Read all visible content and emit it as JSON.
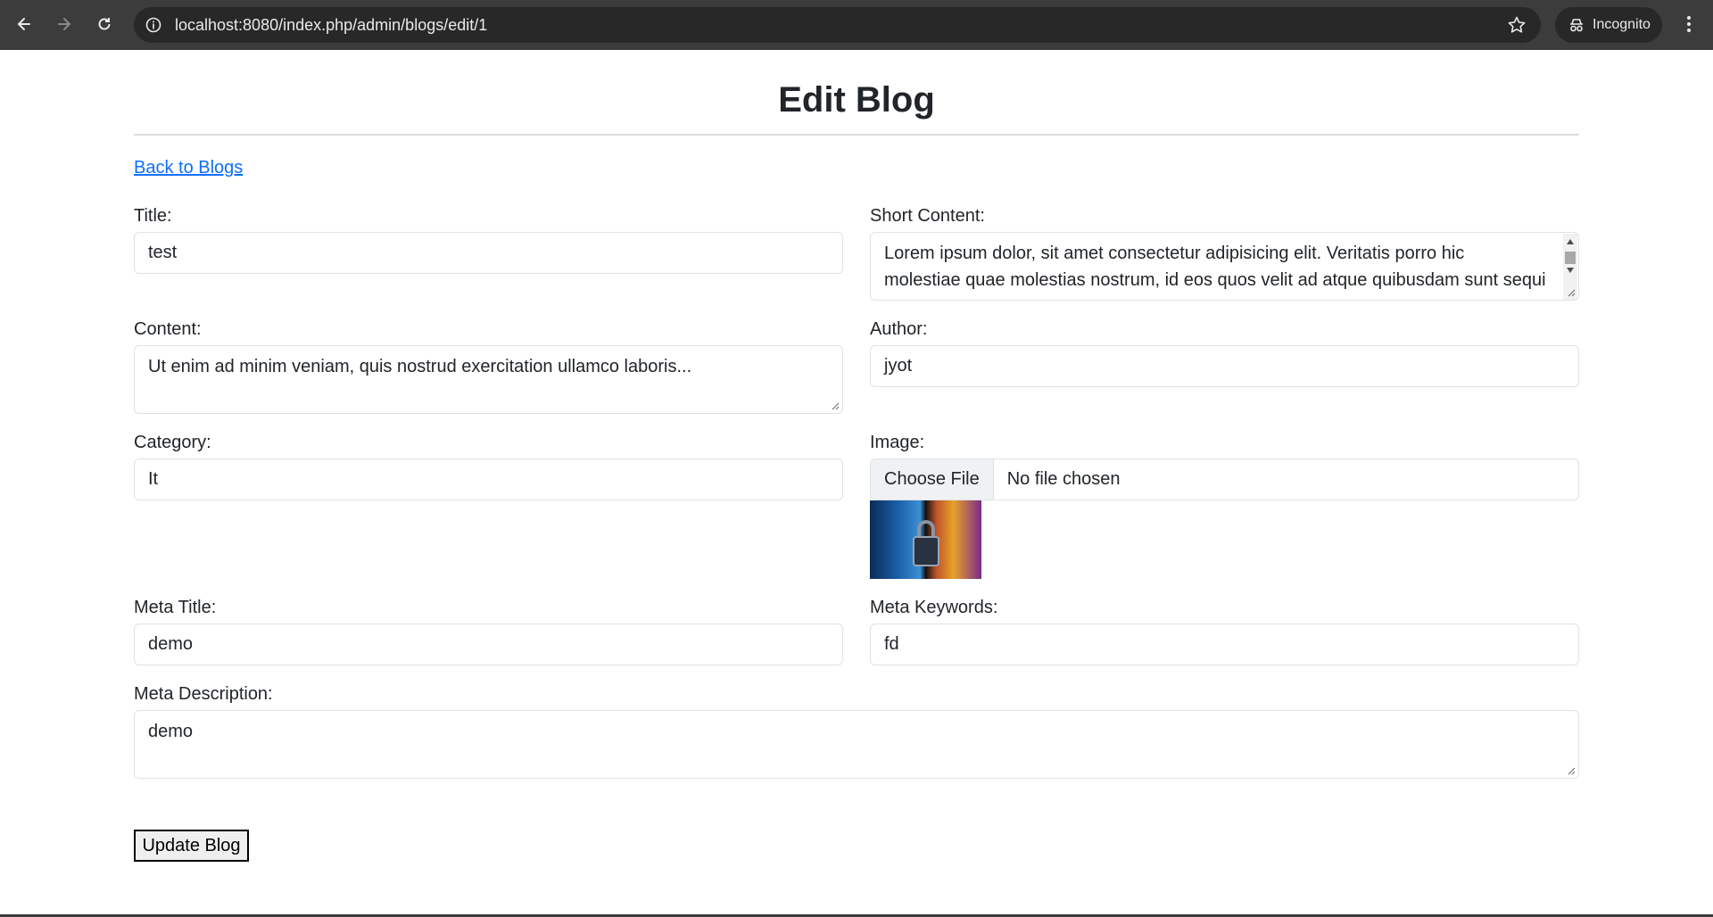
{
  "browser": {
    "url": "localhost:8080/index.php/admin/blogs/edit/1",
    "profile_label": "Incognito"
  },
  "page": {
    "title": "Edit Blog",
    "back_link": "Back to Blogs"
  },
  "form": {
    "title": {
      "label": "Title:",
      "value": "test"
    },
    "short_content": {
      "label": "Short Content:",
      "line1": "Lorem ipsum dolor, sit amet consectetur adipisicing elit. Veritatis porro hic",
      "line2": "molestiae quae molestias nostrum, id eos quos velit ad atque quibusdam sunt sequi"
    },
    "content": {
      "label": "Content:",
      "value": "Ut enim ad minim veniam, quis nostrud exercitation ullamco laboris..."
    },
    "author": {
      "label": "Author:",
      "value": "jyot"
    },
    "category": {
      "label": "Category:",
      "value": "It"
    },
    "image": {
      "label": "Image:",
      "button": "Choose File",
      "status": "No file chosen"
    },
    "meta_title": {
      "label": "Meta Title:",
      "value": "demo"
    },
    "meta_keywords": {
      "label": "Meta Keywords:",
      "value": "fd"
    },
    "meta_description": {
      "label": "Meta Description:",
      "value": "demo"
    },
    "submit_label": "Update Blog"
  },
  "colors": {
    "link": "#0d6efd",
    "chrome_bg": "#3c3c3c",
    "input_border": "#dee2e6"
  }
}
